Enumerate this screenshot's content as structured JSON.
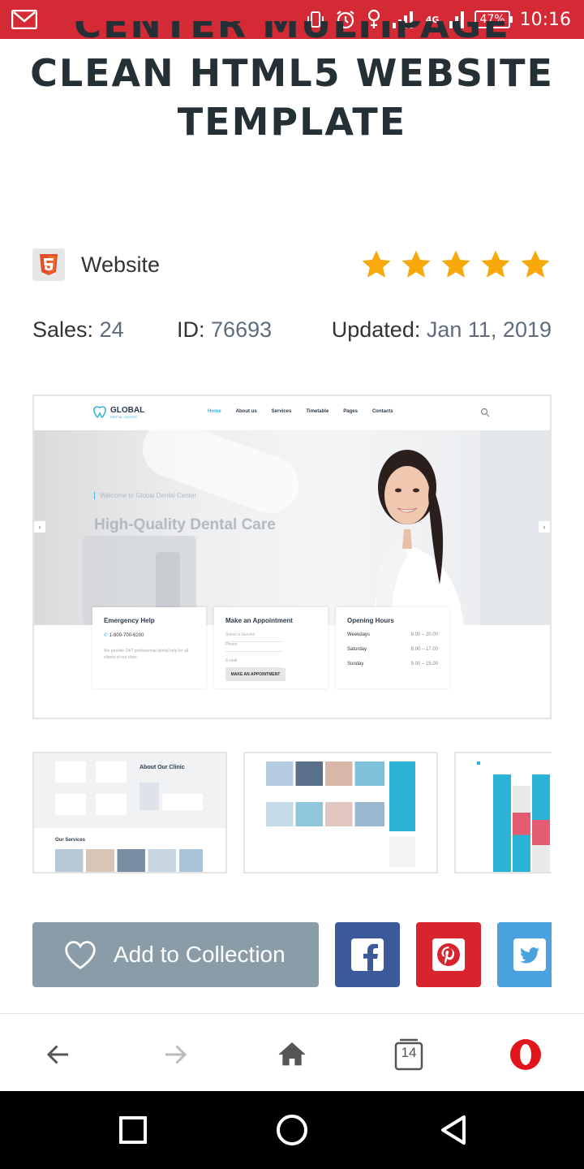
{
  "status_bar": {
    "time": "10:16",
    "battery": "47%",
    "network": "4G",
    "icons": [
      "gmail-icon",
      "vibrate-icon",
      "alarm-icon",
      "location-icon",
      "signal-icon",
      "signal-4g-icon",
      "battery-icon"
    ]
  },
  "product": {
    "title_line1": "CENTER MULTIPAGE",
    "title_line2": "CLEAN HTML5 WEBSITE",
    "title_line3": "TEMPLATE",
    "category": "Website",
    "rating": 5,
    "sales_label": "Sales:",
    "sales_value": "24",
    "id_label": "ID:",
    "id_value": "76693",
    "updated_label": "Updated:",
    "updated_value": "Jan 11, 2019"
  },
  "preview": {
    "logo": "GLOBAL",
    "logo_sub": "DENTAL CENTER",
    "menu": [
      "Home",
      "About us",
      "Services",
      "Timetable",
      "Pages",
      "Contacts"
    ],
    "welcome": "Welcome to Global Dental Center",
    "headline": "High-Quality Dental Care",
    "cards": [
      {
        "title": "Emergency Help",
        "phone": "1-800-700-6200",
        "text": "We provide 24/7 professional dental help for all clients of our clinic."
      },
      {
        "title": "Make an Appointment",
        "select": "Select a Service",
        "phone": "Phone",
        "email": "E-mail",
        "button": "MAKE AN APPOINTMENT"
      },
      {
        "title": "Opening Hours",
        "rows": [
          [
            "Weekdays",
            "8.00 – 20.00"
          ],
          [
            "Saturday",
            "8.00 – 17.00"
          ],
          [
            "Sunday",
            "9.00 – 15.00"
          ]
        ]
      }
    ]
  },
  "thumbs": {
    "t1_heading": "About Our Clinic",
    "t1_services": "Our Services"
  },
  "actions": {
    "collection_label": "Add to Collection"
  },
  "colors": {
    "accent": "#d32a35",
    "star": "#f7a90b",
    "title": "#253036",
    "button": "#8a9ca7",
    "facebook": "#3b5a9a",
    "pinterest": "#d8242e",
    "twitter": "#4aa3df"
  },
  "browser_nav": {
    "tabs_count": "14"
  }
}
